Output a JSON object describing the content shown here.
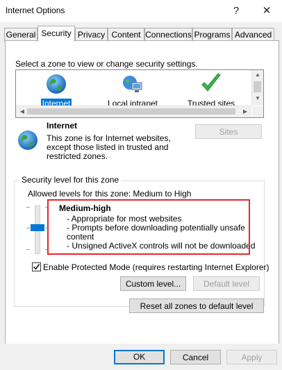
{
  "window": {
    "title": "Internet Options",
    "help_label": "?",
    "close_label": "✕"
  },
  "tabs": [
    {
      "label": "General",
      "active": false
    },
    {
      "label": "Security",
      "active": true
    },
    {
      "label": "Privacy",
      "active": false
    },
    {
      "label": "Content",
      "active": false
    },
    {
      "label": "Connections",
      "active": false
    },
    {
      "label": "Programs",
      "active": false
    },
    {
      "label": "Advanced",
      "active": false
    }
  ],
  "security": {
    "instruction": "Select a zone to view or change security settings.",
    "zones": [
      {
        "label": "Internet",
        "icon": "globe-icon",
        "selected": true
      },
      {
        "label": "Local intranet",
        "icon": "network-icon",
        "selected": false
      },
      {
        "label": "Trusted sites",
        "icon": "checkmark-icon",
        "selected": false
      }
    ],
    "zone_info": {
      "name": "Internet",
      "description_lines": [
        "This zone is for Internet websites,",
        "except those listed in trusted and",
        "restricted zones."
      ]
    },
    "sites_button": "Sites",
    "level_group_title": "Security level for this zone",
    "allowed_levels": "Allowed levels for this zone: Medium to High",
    "level_name": "Medium-high",
    "level_bullets": [
      "- Appropriate for most websites",
      "- Prompts before downloading potentially unsafe",
      "  content",
      "- Unsigned ActiveX controls will not be downloaded"
    ],
    "protected_mode_label": "Enable Protected Mode (requires restarting Internet Explorer)",
    "protected_mode_checked": true,
    "custom_level_button": "Custom level...",
    "default_level_button": "Default level",
    "reset_all_button": "Reset all zones to default level"
  },
  "footer": {
    "ok": "OK",
    "cancel": "Cancel",
    "apply": "Apply"
  },
  "colors": {
    "accent": "#0078d7",
    "highlight_border": "#e8262c"
  }
}
